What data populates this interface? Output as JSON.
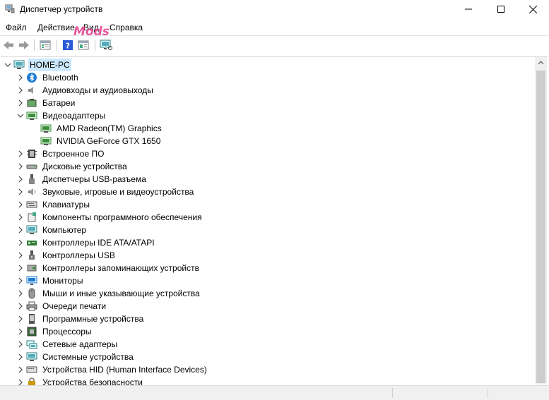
{
  "window": {
    "title": "Диспетчер устройств"
  },
  "menu": [
    "Файл",
    "Действие",
    "Вид",
    "Справка"
  ],
  "watermark": "Mods",
  "tree": {
    "root": "HOME-PC",
    "items": [
      {
        "label": "Bluetooth",
        "icon": "bluetooth-icon",
        "expanded": false
      },
      {
        "label": "Аудиовходы и аудиовыходы",
        "icon": "speaker-icon",
        "expanded": false
      },
      {
        "label": "Батареи",
        "icon": "battery-icon",
        "expanded": false
      },
      {
        "label": "Видеоадаптеры",
        "icon": "display-adapter-icon",
        "expanded": true
      },
      {
        "label": "AMD Radeon(TM) Graphics",
        "icon": "display-adapter-icon",
        "child": true
      },
      {
        "label": "NVIDIA GeForce GTX 1650",
        "icon": "display-adapter-icon",
        "child": true
      },
      {
        "label": "Встроенное ПО",
        "icon": "firmware-icon",
        "expanded": false
      },
      {
        "label": "Дисковые устройства",
        "icon": "disk-drive-icon",
        "expanded": false
      },
      {
        "label": "Диспетчеры USB-разъема",
        "icon": "usb-connector-icon",
        "expanded": false
      },
      {
        "label": "Звуковые, игровые и видеоустройства",
        "icon": "sound-icon",
        "expanded": false
      },
      {
        "label": "Клавиатуры",
        "icon": "keyboard-icon",
        "expanded": false
      },
      {
        "label": "Компоненты программного обеспечения",
        "icon": "software-component-icon",
        "expanded": false
      },
      {
        "label": "Компьютер",
        "icon": "computer-icon",
        "expanded": false
      },
      {
        "label": "Контроллеры IDE ATA/ATAPI",
        "icon": "ide-controller-icon",
        "expanded": false
      },
      {
        "label": "Контроллеры USB",
        "icon": "usb-icon",
        "expanded": false
      },
      {
        "label": "Контроллеры запоминающих устройств",
        "icon": "storage-controller-icon",
        "expanded": false
      },
      {
        "label": "Мониторы",
        "icon": "monitor-icon",
        "expanded": false
      },
      {
        "label": "Мыши и иные указывающие устройства",
        "icon": "mouse-icon",
        "expanded": false
      },
      {
        "label": "Очереди печати",
        "icon": "printer-icon",
        "expanded": false
      },
      {
        "label": "Программные устройства",
        "icon": "software-device-icon",
        "expanded": false
      },
      {
        "label": "Процессоры",
        "icon": "processor-icon",
        "expanded": false
      },
      {
        "label": "Сетевые адаптеры",
        "icon": "network-adapter-icon",
        "expanded": false
      },
      {
        "label": "Системные устройства",
        "icon": "system-device-icon",
        "expanded": false
      },
      {
        "label": "Устройства HID (Human Interface Devices)",
        "icon": "hid-icon",
        "expanded": false
      },
      {
        "label": "Устройства безопасности",
        "icon": "security-device-icon",
        "expanded": false
      }
    ]
  },
  "colors": {
    "selection": "#cce8ff",
    "icon_blue": "#1e7bd3",
    "icon_green": "#3b8f3b",
    "watermark": "#e23c8e"
  }
}
